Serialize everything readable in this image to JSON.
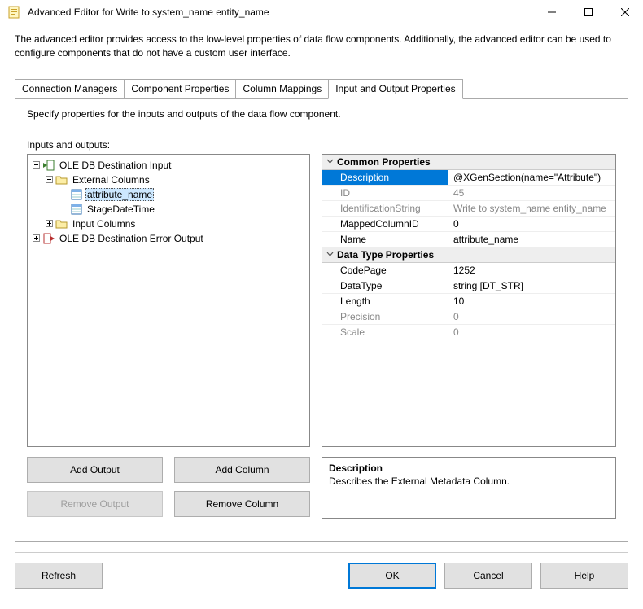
{
  "window": {
    "title": "Advanced Editor for Write to system_name entity_name"
  },
  "topdesc": "The advanced editor provides access to the low-level properties of data flow components. Additionally, the advanced editor can be used to configure components that do not have a custom user interface.",
  "tabs": [
    "Connection Managers",
    "Component Properties",
    "Column Mappings",
    "Input and Output Properties"
  ],
  "activeTab": 3,
  "tabdesc": "Specify properties for the inputs and outputs of the data flow component.",
  "ioLabel": "Inputs and outputs:",
  "tree": {
    "root1": "OLE DB Destination Input",
    "ext": "External Columns",
    "attr": "attribute_name",
    "stage": "StageDateTime",
    "inputcols": "Input Columns",
    "root2": "OLE DB Destination Error Output"
  },
  "propgrid": {
    "cat1": "Common Properties",
    "rows1": [
      {
        "name": "Description",
        "value": "@XGenSection(name=\"Attribute\")",
        "selected": true
      },
      {
        "name": "ID",
        "value": "45",
        "readonly": true
      },
      {
        "name": "IdentificationString",
        "value": "Write to system_name entity_name",
        "readonly": true
      },
      {
        "name": "MappedColumnID",
        "value": "0"
      },
      {
        "name": "Name",
        "value": "attribute_name"
      }
    ],
    "cat2": "Data Type Properties",
    "rows2": [
      {
        "name": "CodePage",
        "value": "1252"
      },
      {
        "name": "DataType",
        "value": "string [DT_STR]"
      },
      {
        "name": "Length",
        "value": "10"
      },
      {
        "name": "Precision",
        "value": "0",
        "readonly": true
      },
      {
        "name": "Scale",
        "value": "0",
        "readonly": true
      }
    ]
  },
  "descbox": {
    "title": "Description",
    "body": "Describes the External Metadata Column."
  },
  "buttons": {
    "addOutput": "Add Output",
    "addColumn": "Add Column",
    "removeOutput": "Remove Output",
    "removeColumn": "Remove Column",
    "refresh": "Refresh",
    "ok": "OK",
    "cancel": "Cancel",
    "help": "Help"
  }
}
